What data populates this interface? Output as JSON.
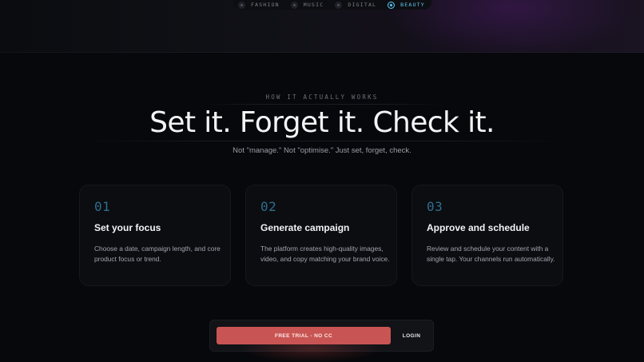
{
  "categories": [
    {
      "label": "FASHION",
      "icon": "circle-dot-icon",
      "active": false
    },
    {
      "label": "MUSIC",
      "icon": "circle-dot-icon",
      "active": false
    },
    {
      "label": "DIGITAL",
      "icon": "circle-dot-icon",
      "active": false
    },
    {
      "label": "BEAUTY",
      "icon": "circle-dot-icon",
      "active": true
    }
  ],
  "section": {
    "eyebrow": "HOW IT ACTUALLY WORKS",
    "headline": "Set it. Forget it. Check it.",
    "subline": "Not \"manage.\" Not \"optimise.\" Just set, forget, check."
  },
  "steps": [
    {
      "number": "01",
      "title": "Set your focus",
      "description": "Choose a date, campaign length, and core product focus or trend."
    },
    {
      "number": "02",
      "title": "Generate campaign",
      "description": "The platform creates high-quality images, video, and copy matching your brand voice."
    },
    {
      "number": "03",
      "title": "Approve and schedule",
      "description": "Review and schedule your content with a single tap. Your channels run automatically."
    }
  ],
  "cta": {
    "trial_label": "FREE TRIAL - NO CC",
    "login_label": "LOGIN"
  },
  "colors": {
    "background": "#07080b",
    "accent": "#5fc6ee",
    "step_number": "#2d6f8e",
    "cta": "#c85553"
  }
}
